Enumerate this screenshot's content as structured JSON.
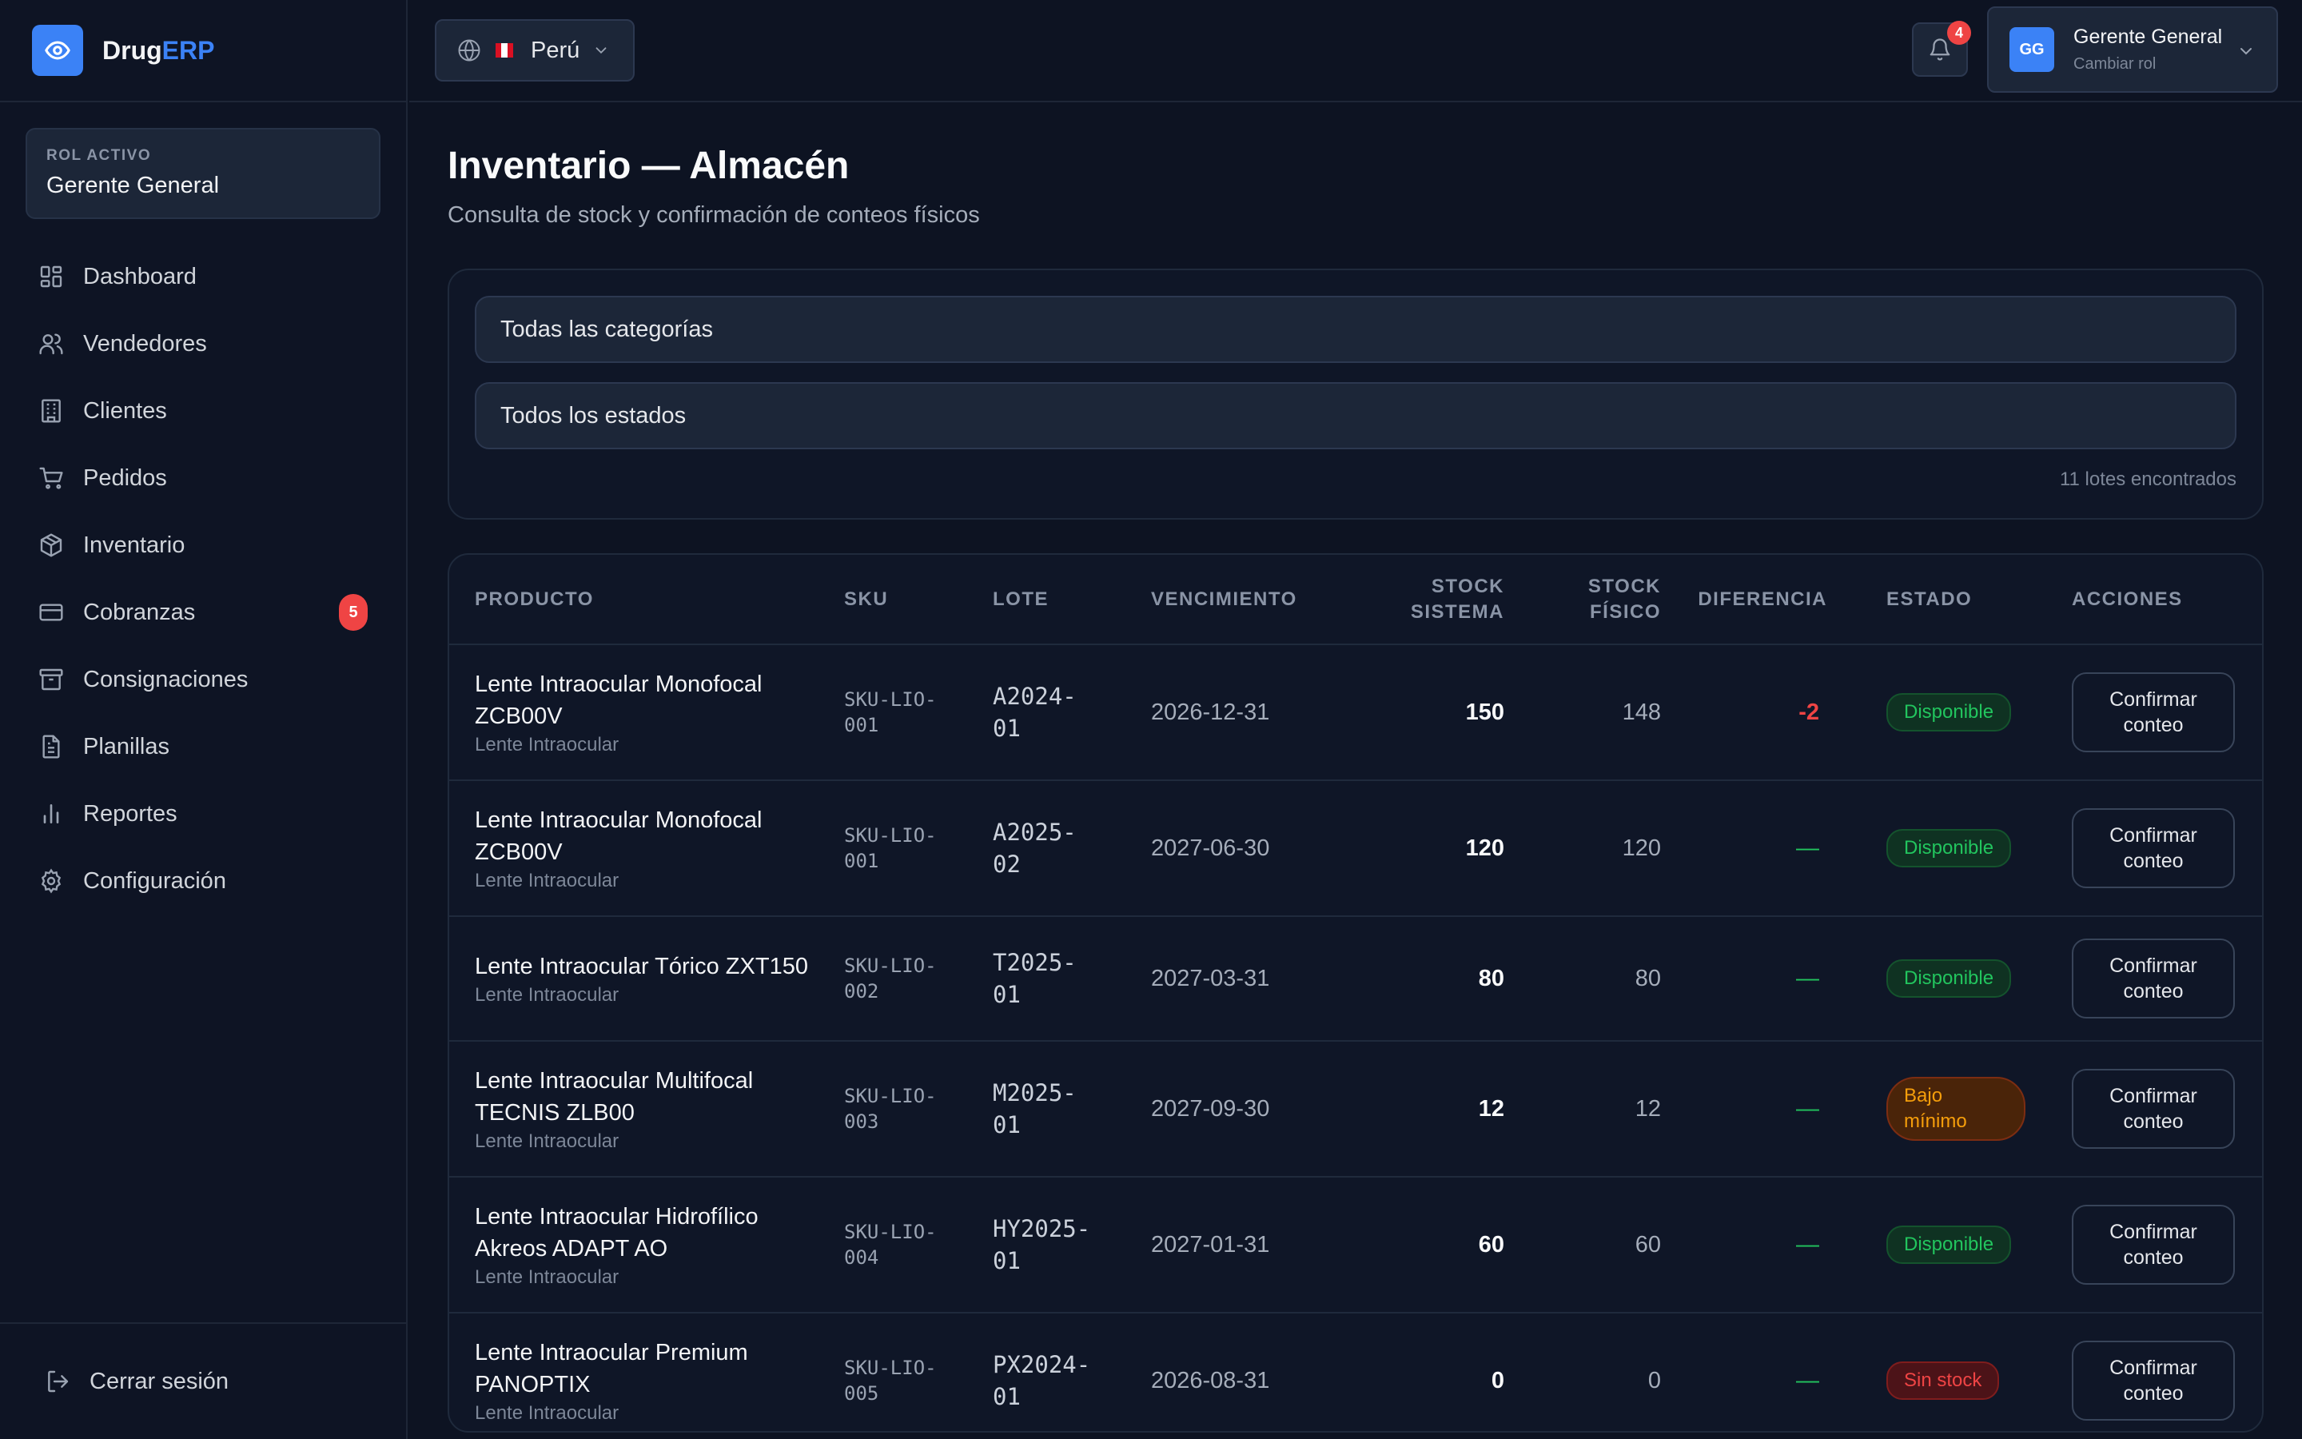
{
  "brand": {
    "name_part1": "Drug",
    "name_part2": "ERP"
  },
  "sidebar": {
    "role_label": "ROL ACTIVO",
    "role_value": "Gerente General",
    "items": [
      {
        "label": "Dashboard",
        "icon": "dashboard-icon"
      },
      {
        "label": "Vendedores",
        "icon": "users-icon"
      },
      {
        "label": "Clientes",
        "icon": "building-icon"
      },
      {
        "label": "Pedidos",
        "icon": "cart-icon"
      },
      {
        "label": "Inventario",
        "icon": "package-icon"
      },
      {
        "label": "Cobranzas",
        "icon": "credit-card-icon",
        "badge": "5"
      },
      {
        "label": "Consignaciones",
        "icon": "archive-icon"
      },
      {
        "label": "Planillas",
        "icon": "file-text-icon"
      },
      {
        "label": "Reportes",
        "icon": "bar-chart-icon"
      },
      {
        "label": "Configuración",
        "icon": "gear-icon"
      }
    ],
    "logout": "Cerrar sesión"
  },
  "header": {
    "country": "Perú",
    "notifications": "4",
    "user": {
      "initials": "GG",
      "name": "Gerente General",
      "sub": "Cambiar rol"
    }
  },
  "page": {
    "title": "Inventario — Almacén",
    "subtitle": "Consulta de stock y confirmación de conteos físicos"
  },
  "filters": {
    "category": "Todas las categorías",
    "status": "Todos los estados",
    "count": "11 lotes encontrados"
  },
  "table": {
    "headers": {
      "producto": "PRODUCTO",
      "sku": "SKU",
      "lote": "LOTE",
      "vencimiento": "VENCIMIENTO",
      "stock_sistema_1": "STOCK",
      "stock_sistema_2": "SISTEMA",
      "stock_fisico_1": "STOCK",
      "stock_fisico_2": "FÍSICO",
      "diferencia": "DIFERENCIA",
      "estado": "ESTADO",
      "acciones": "ACCIONES"
    },
    "action_label_1": "Confirmar",
    "action_label_2": "conteo",
    "rows": [
      {
        "name": "Lente Intraocular Monofocal ZCB00V",
        "category": "Lente Intraocular",
        "sku1": "SKU-LIO-",
        "sku2": "001",
        "lote1": "A2024-",
        "lote2": "01",
        "vencimiento": "2026-12-31",
        "stock_sistema": "150",
        "stock_fisico": "148",
        "diferencia": "-2",
        "estado": "Disponible",
        "estado_tipo": "green"
      },
      {
        "name": "Lente Intraocular Monofocal ZCB00V",
        "category": "Lente Intraocular",
        "sku1": "SKU-LIO-",
        "sku2": "001",
        "lote1": "A2025-",
        "lote2": "02",
        "vencimiento": "2027-06-30",
        "stock_sistema": "120",
        "stock_fisico": "120",
        "diferencia": "—",
        "estado": "Disponible",
        "estado_tipo": "green"
      },
      {
        "name": "Lente Intraocular Tórico ZXT150",
        "category": "Lente Intraocular",
        "sku1": "SKU-LIO-",
        "sku2": "002",
        "lote1": "T2025-",
        "lote2": "01",
        "vencimiento": "2027-03-31",
        "stock_sistema": "80",
        "stock_fisico": "80",
        "diferencia": "—",
        "estado": "Disponible",
        "estado_tipo": "green"
      },
      {
        "name": "Lente Intraocular Multifocal TECNIS ZLB00",
        "category": "Lente Intraocular",
        "sku1": "SKU-LIO-",
        "sku2": "003",
        "lote1": "M2025-",
        "lote2": "01",
        "vencimiento": "2027-09-30",
        "stock_sistema": "12",
        "stock_fisico": "12",
        "diferencia": "—",
        "estado": "Bajo mínimo",
        "estado_tipo": "orange"
      },
      {
        "name": "Lente Intraocular Hidrofílico Akreos ADAPT AO",
        "category": "Lente Intraocular",
        "sku1": "SKU-LIO-",
        "sku2": "004",
        "lote1": "HY2025-",
        "lote2": "01",
        "vencimiento": "2027-01-31",
        "stock_sistema": "60",
        "stock_fisico": "60",
        "diferencia": "—",
        "estado": "Disponible",
        "estado_tipo": "green"
      },
      {
        "name": "Lente Intraocular Premium PANOPTIX",
        "category": "Lente Intraocular",
        "sku1": "SKU-LIO-",
        "sku2": "005",
        "lote1": "PX2024-",
        "lote2": "01",
        "vencimiento": "2026-08-31",
        "stock_sistema": "0",
        "stock_fisico": "0",
        "diferencia": "—",
        "estado": "Sin stock",
        "estado_tipo": "red"
      }
    ]
  },
  "colors": {
    "accent": "#3b82f6",
    "background": "#0d1322",
    "danger": "#ef4444",
    "success": "#22c55e",
    "warning": "#f59e0b"
  }
}
